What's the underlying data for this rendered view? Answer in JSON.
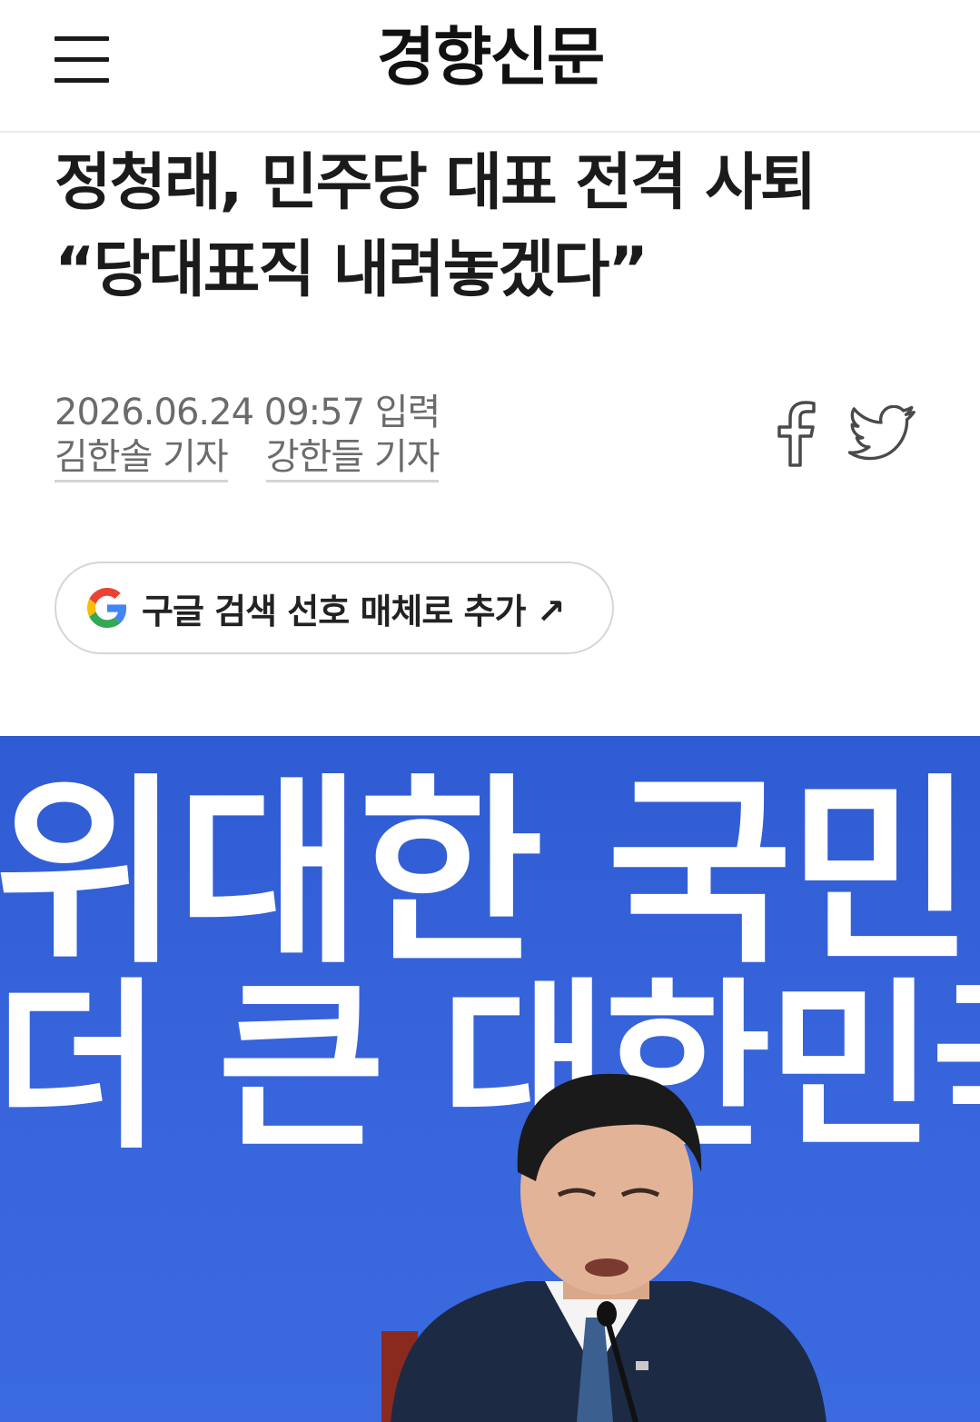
{
  "header": {
    "menu_icon": "hamburger-menu-icon",
    "logo": "경향신문"
  },
  "article": {
    "headline_line1": "정청래, 민주당 대표 전격 사퇴",
    "headline_line2": "“당대표직 내려놓겠다”",
    "timestamp": "2026.06.24 09:57 입력",
    "authors": [
      "김한솔 기자",
      "강한들 기자"
    ]
  },
  "share": {
    "facebook_icon": "facebook-icon",
    "twitter_icon": "twitter-icon"
  },
  "google_button": {
    "icon": "google-g-icon",
    "label": "구글 검색 선호 매체로 추가 ↗"
  },
  "photo": {
    "banner_line1": "위대한 국민",
    "banner_line2": "더 큰 대한민국",
    "background_color": "#3763db"
  }
}
